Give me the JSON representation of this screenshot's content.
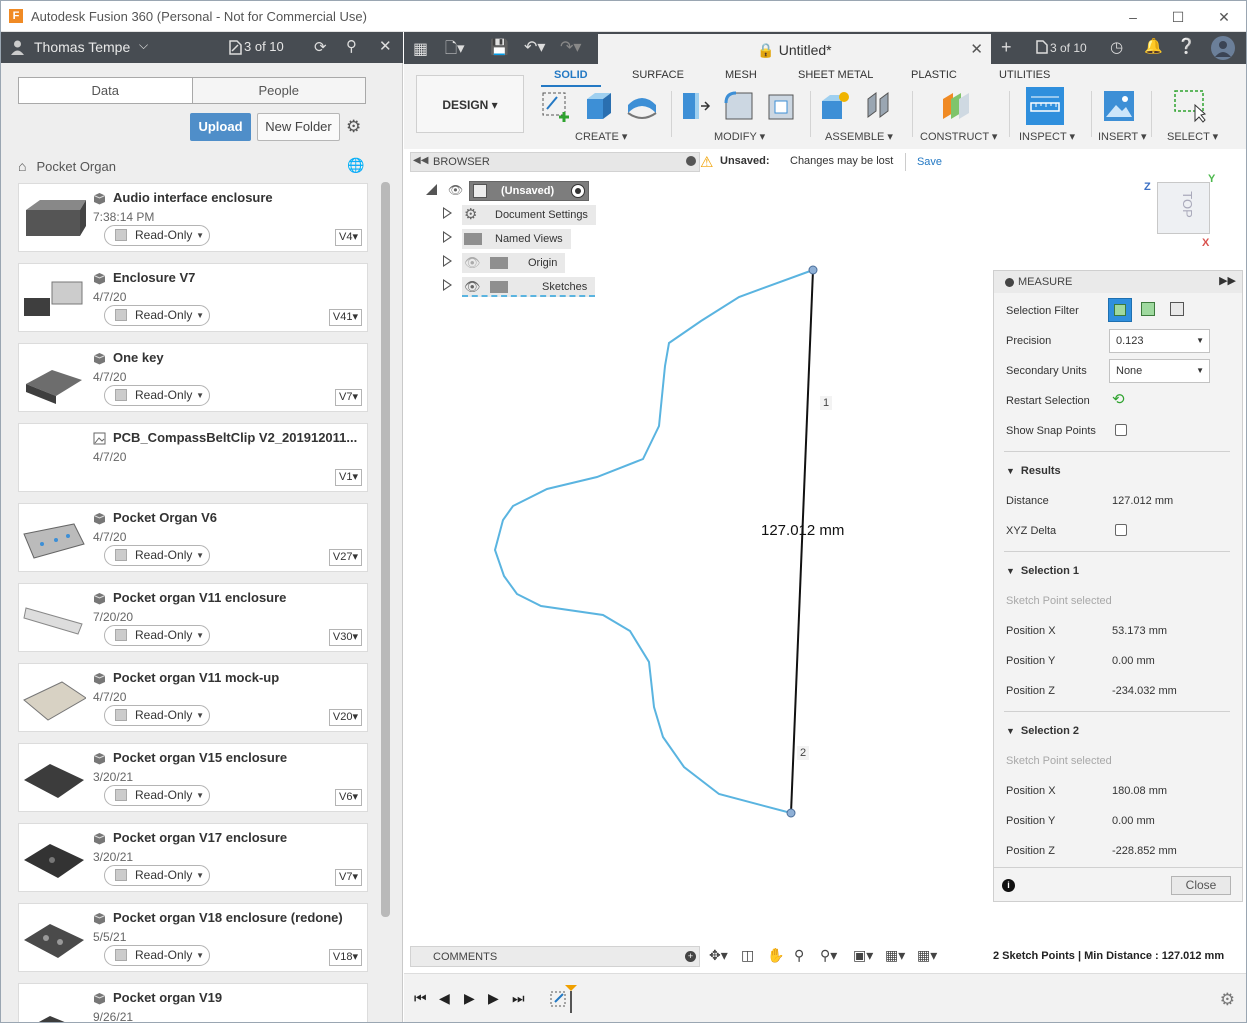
{
  "window": {
    "title": "Autodesk Fusion 360 (Personal - Not for Commercial Use)",
    "logo": "F",
    "controls": [
      "–",
      "☐",
      "✕"
    ]
  },
  "data_panel": {
    "user": "Thomas Tempe",
    "job_count": "3 of 10",
    "tabs": [
      "Data",
      "People"
    ],
    "upload_label": "Upload",
    "new_folder_label": "New Folder",
    "breadcrumb": "Pocket Organ",
    "read_only_label": "Read-Only",
    "items": [
      {
        "name": "Audio interface enclosure",
        "date": "7:38:14 PM",
        "version": "V4",
        "read_only": true
      },
      {
        "name": "Enclosure V7",
        "date": "4/7/20",
        "version": "V41",
        "read_only": true
      },
      {
        "name": "One key",
        "date": "4/7/20",
        "version": "V7",
        "read_only": true
      },
      {
        "name": "PCB_CompassBeltClip V2_201912011...",
        "date": "4/7/20",
        "version": "V1",
        "read_only": false
      },
      {
        "name": "Pocket Organ V6",
        "date": "4/7/20",
        "version": "V27",
        "read_only": true
      },
      {
        "name": "Pocket organ V11 enclosure",
        "date": "7/20/20",
        "version": "V30",
        "read_only": true
      },
      {
        "name": "Pocket organ V11 mock-up",
        "date": "4/7/20",
        "version": "V20",
        "read_only": true
      },
      {
        "name": "Pocket organ V15 enclosure",
        "date": "3/20/21",
        "version": "V6",
        "read_only": true
      },
      {
        "name": "Pocket organ V17 enclosure",
        "date": "3/20/21",
        "version": "V7",
        "read_only": true
      },
      {
        "name": "Pocket organ V18 enclosure (redone)",
        "date": "5/5/21",
        "version": "V18",
        "read_only": true
      },
      {
        "name": "Pocket organ V19",
        "date": "9/26/21",
        "version": "",
        "read_only": false
      }
    ]
  },
  "document": {
    "tab_title": "Untitled*",
    "job_count": "3 of 10"
  },
  "ribbon": {
    "workspace": "DESIGN",
    "tabs": [
      "SOLID",
      "SURFACE",
      "MESH",
      "SHEET METAL",
      "PLASTIC",
      "UTILITIES"
    ],
    "active_tab": "SOLID",
    "groups": [
      "CREATE",
      "MODIFY",
      "ASSEMBLE",
      "CONSTRUCT",
      "INSPECT",
      "INSERT",
      "SELECT"
    ]
  },
  "browser": {
    "label": "BROWSER",
    "warning_title": "Unsaved:",
    "warning_message": "Changes may be lost",
    "save_label": "Save",
    "nodes": [
      "(Unsaved)",
      "Document Settings",
      "Named Views",
      "Origin",
      "Sketches"
    ]
  },
  "viewport": {
    "dimension_text": "127.012 mm",
    "point_labels": [
      "1",
      "2"
    ],
    "viewcube_face": "TOP",
    "axes": [
      "Z",
      "Y",
      "X"
    ],
    "colors": {
      "sketch_profile": "#5ab4e0",
      "measure_line": "#111111",
      "point": "#5a7fa8"
    }
  },
  "measure": {
    "title": "MEASURE",
    "selection_filter": "Selection Filter",
    "precision_label": "Precision",
    "precision_value": "0.123",
    "secondary_units_label": "Secondary Units",
    "secondary_units_value": "None",
    "restart_selection": "Restart Selection",
    "show_snap_points": "Show Snap Points",
    "results_label": "Results",
    "distance_label": "Distance",
    "distance_value": "127.012 mm",
    "xyz_delta": "XYZ Delta",
    "selection1": {
      "label": "Selection 1",
      "type": "Sketch Point selected",
      "x_label": "Position X",
      "x": "53.173 mm",
      "y_label": "Position Y",
      "y": "0.00 mm",
      "z_label": "Position Z",
      "z": "-234.032 mm"
    },
    "selection2": {
      "label": "Selection 2",
      "type": "Sketch Point selected",
      "x_label": "Position X",
      "x": "180.08 mm",
      "y_label": "Position Y",
      "y": "0.00 mm",
      "z_label": "Position Z",
      "z": "-228.852 mm"
    },
    "close_label": "Close"
  },
  "bottom": {
    "comments_label": "COMMENTS",
    "status": "2 Sketch Points | Min Distance : 127.012 mm"
  }
}
